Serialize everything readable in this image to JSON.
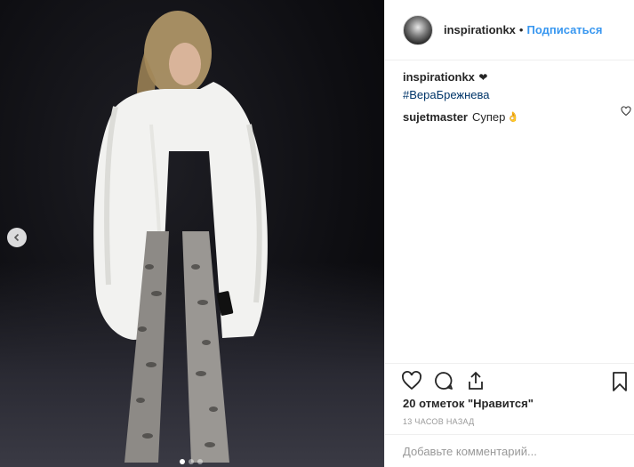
{
  "post": {
    "username": "inspirationkx",
    "bullet": "•",
    "follow_label": "Подписаться",
    "caption_emoji": "❤",
    "hashtag": "#ВераБрежнева",
    "comments": [
      {
        "user": "sujetmaster",
        "text": "Супер",
        "emoji": "👌"
      }
    ],
    "likes_text": "20 отметок \"Нравится\"",
    "time_text": "13 часов назад",
    "comment_placeholder": "Добавьте комментарий..."
  },
  "carousel": {
    "total": 3,
    "active_index": 0
  },
  "icons": {
    "like": "heart-icon",
    "comment": "comment-icon",
    "share": "share-icon",
    "save": "bookmark-icon",
    "prev": "chevron-left-icon"
  },
  "colors": {
    "link": "#3897f0",
    "hashtag": "#003569",
    "text": "#262626",
    "muted": "#999999"
  }
}
